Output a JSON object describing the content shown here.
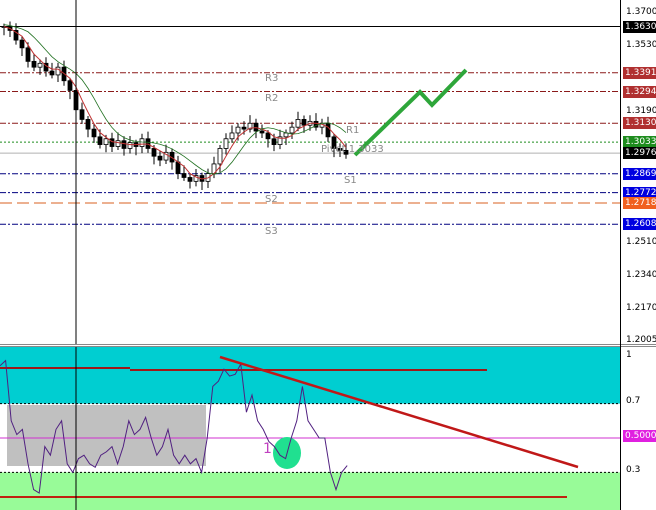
{
  "price_axis": {
    "ticks": [
      "1.3700",
      "1.3530",
      "1.3190",
      "1.2510",
      "1.2340",
      "1.2170",
      "1.2005"
    ],
    "tags": [
      {
        "label": "1.3630",
        "value": 1.363,
        "color": "#000000"
      },
      {
        "label": "1.3391",
        "value": 1.3391,
        "color": "#b03030"
      },
      {
        "label": "1.3294",
        "value": 1.3294,
        "color": "#b03030"
      },
      {
        "label": "1.3130",
        "value": 1.313,
        "color": "#b03030"
      },
      {
        "label": "1.3033",
        "value": 1.3033,
        "color": "#1e8c1e"
      },
      {
        "label": "1.2976",
        "value": 1.2976,
        "color": "#000000"
      },
      {
        "label": "1.2869",
        "value": 1.2869,
        "color": "#0000e0"
      },
      {
        "label": "1.2772",
        "value": 1.2772,
        "color": "#0000e0"
      },
      {
        "label": "1.2718",
        "value": 1.2718,
        "color": "#f06020"
      },
      {
        "label": "1.2608",
        "value": 1.2608,
        "color": "#0000e0"
      }
    ]
  },
  "levels": [
    {
      "name": "R3",
      "value": 1.3391,
      "color": "#8b1a1a",
      "style": "dashdot"
    },
    {
      "name": "R2",
      "value": 1.3294,
      "color": "#8b1a1a",
      "style": "dashdot"
    },
    {
      "name": "R1",
      "value": 1.313,
      "color": "#8b1a1a",
      "style": "dashdot"
    },
    {
      "name": "Pivot 1.3033",
      "value": 1.3033,
      "color": "#1e8c1e",
      "style": "dot"
    },
    {
      "name": "S1",
      "value": 1.2869,
      "color": "#000080",
      "style": "dashdot"
    },
    {
      "name": "S2",
      "value": 1.2772,
      "color": "#000080",
      "style": "dashdot"
    },
    {
      "name": "S3",
      "value": 1.2608,
      "color": "#000080",
      "style": "dashdot"
    }
  ],
  "extra_lines": {
    "current": 1.2976,
    "orange": 1.2718,
    "top": 1.363
  },
  "candles_close": [
    1.363,
    1.361,
    1.356,
    1.352,
    1.345,
    1.342,
    1.344,
    1.34,
    1.338,
    1.342,
    1.335,
    1.33,
    1.32,
    1.315,
    1.31,
    1.306,
    1.302,
    1.305,
    1.301,
    1.304,
    1.3,
    1.303,
    1.301,
    1.305,
    1.3,
    1.296,
    1.294,
    1.298,
    1.293,
    1.287,
    1.285,
    1.283,
    1.286,
    1.283,
    1.287,
    1.292,
    1.3,
    1.305,
    1.308,
    1.311,
    1.31,
    1.313,
    1.309,
    1.308,
    1.305,
    1.302,
    1.306,
    1.308,
    1.311,
    1.315,
    1.312,
    1.314,
    1.311,
    1.313,
    1.306,
    1.3,
    1.299,
    1.297
  ],
  "oscillator": {
    "axis": [
      "1",
      "0.7",
      "0.3"
    ],
    "tag": "0.5000",
    "label": "1",
    "values": [
      0.92,
      0.95,
      0.6,
      0.52,
      0.55,
      0.35,
      0.2,
      0.18,
      0.45,
      0.4,
      0.55,
      0.6,
      0.35,
      0.3,
      0.38,
      0.4,
      0.35,
      0.33,
      0.4,
      0.42,
      0.45,
      0.35,
      0.45,
      0.6,
      0.52,
      0.55,
      0.62,
      0.5,
      0.4,
      0.45,
      0.55,
      0.4,
      0.35,
      0.4,
      0.35,
      0.38,
      0.3,
      0.5,
      0.8,
      0.83,
      0.9,
      0.86,
      0.87,
      0.93,
      0.65,
      0.75,
      0.6,
      0.55,
      0.48,
      0.45,
      0.4,
      0.38,
      0.5,
      0.6,
      0.8,
      0.6,
      0.55,
      0.5,
      0.5,
      0.3,
      0.2,
      0.3,
      0.34
    ]
  }
}
